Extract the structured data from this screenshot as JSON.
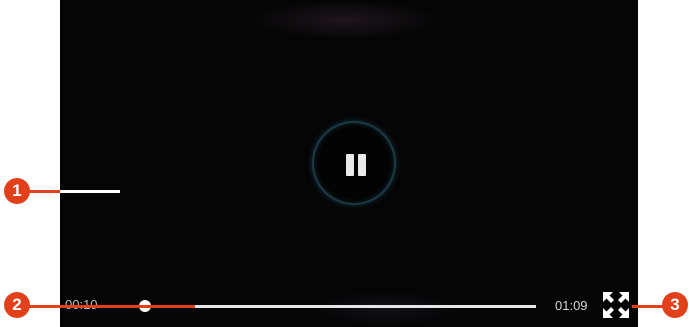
{
  "player": {
    "current_time": "00:10",
    "total_time": "01:09",
    "progress": 0.065,
    "state": "playing",
    "pause_icon": "pause-icon",
    "fullscreen_icon": "fullscreen-icon"
  },
  "callouts": [
    "1",
    "2",
    "3"
  ],
  "colors": {
    "callout": "#e2401b",
    "background": "#050506",
    "track": "#e6e6e6"
  }
}
